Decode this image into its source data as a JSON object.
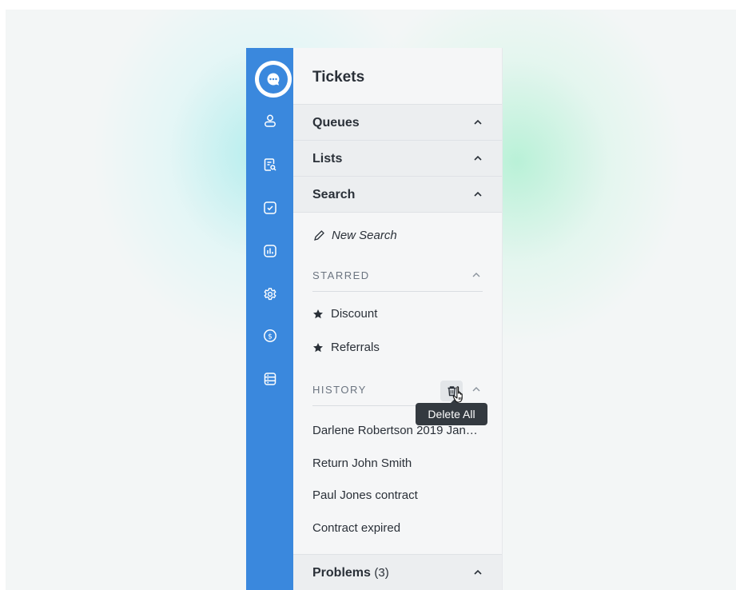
{
  "panel": {
    "title": "Tickets"
  },
  "sections": {
    "queues": {
      "label": "Queues"
    },
    "lists": {
      "label": "Lists"
    },
    "search": {
      "label": "Search"
    },
    "problems": {
      "label": "Problems",
      "count": "(3)"
    }
  },
  "search": {
    "new_search_label": "New Search",
    "starred": {
      "label": "STARRED",
      "items": [
        "Discount",
        "Referrals"
      ]
    },
    "history": {
      "label": "HISTORY",
      "items": [
        "Darlene Robertson 2019 Jan…",
        "Return John Smith",
        "Paul Jones contract",
        "Contract expired"
      ]
    }
  },
  "tooltip": {
    "text": "Delete All"
  },
  "nav_icons": [
    "chat-icon",
    "user-icon",
    "search-document-icon",
    "checkbox-icon",
    "report-chart-icon",
    "settings-icon",
    "billing-icon",
    "database-icon"
  ],
  "colors": {
    "accent": "#3a88dd",
    "panel_bg": "#f5f6f7",
    "header_bg": "#eceef0",
    "text": "#2a3038",
    "tooltip_bg": "#343a40"
  }
}
